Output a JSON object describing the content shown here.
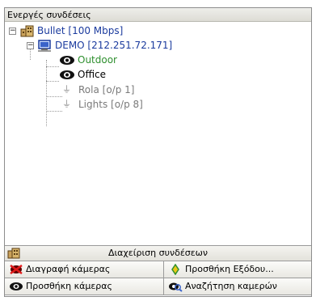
{
  "panel": {
    "title": "Ενεργές συνδέσεις"
  },
  "tree": {
    "root": {
      "label": "Bullet  [100 Mbps]"
    },
    "server": {
      "label": "DEMO [212.251.72.171]"
    },
    "cameras": [
      {
        "label": "Outdoor",
        "selected": true
      },
      {
        "label": "Office",
        "selected": false
      }
    ],
    "outputs": [
      {
        "label": "Rola  [o/p 1]"
      },
      {
        "label": "Lights  [o/p 8]"
      }
    ]
  },
  "toolbar": {
    "manage_connections": "Διαχείριση συνδέσεων",
    "delete_camera": "Διαγραφή κάμερας",
    "add_output": "Προσθήκη Εξόδου...",
    "add_camera": "Προσθήκη κάμερας",
    "search_cameras": "Αναζήτηση καμερών"
  },
  "colors": {
    "selected_text": "#2e8f2e",
    "link_text": "#1b3b9e",
    "output_text": "#7a7a7a"
  }
}
